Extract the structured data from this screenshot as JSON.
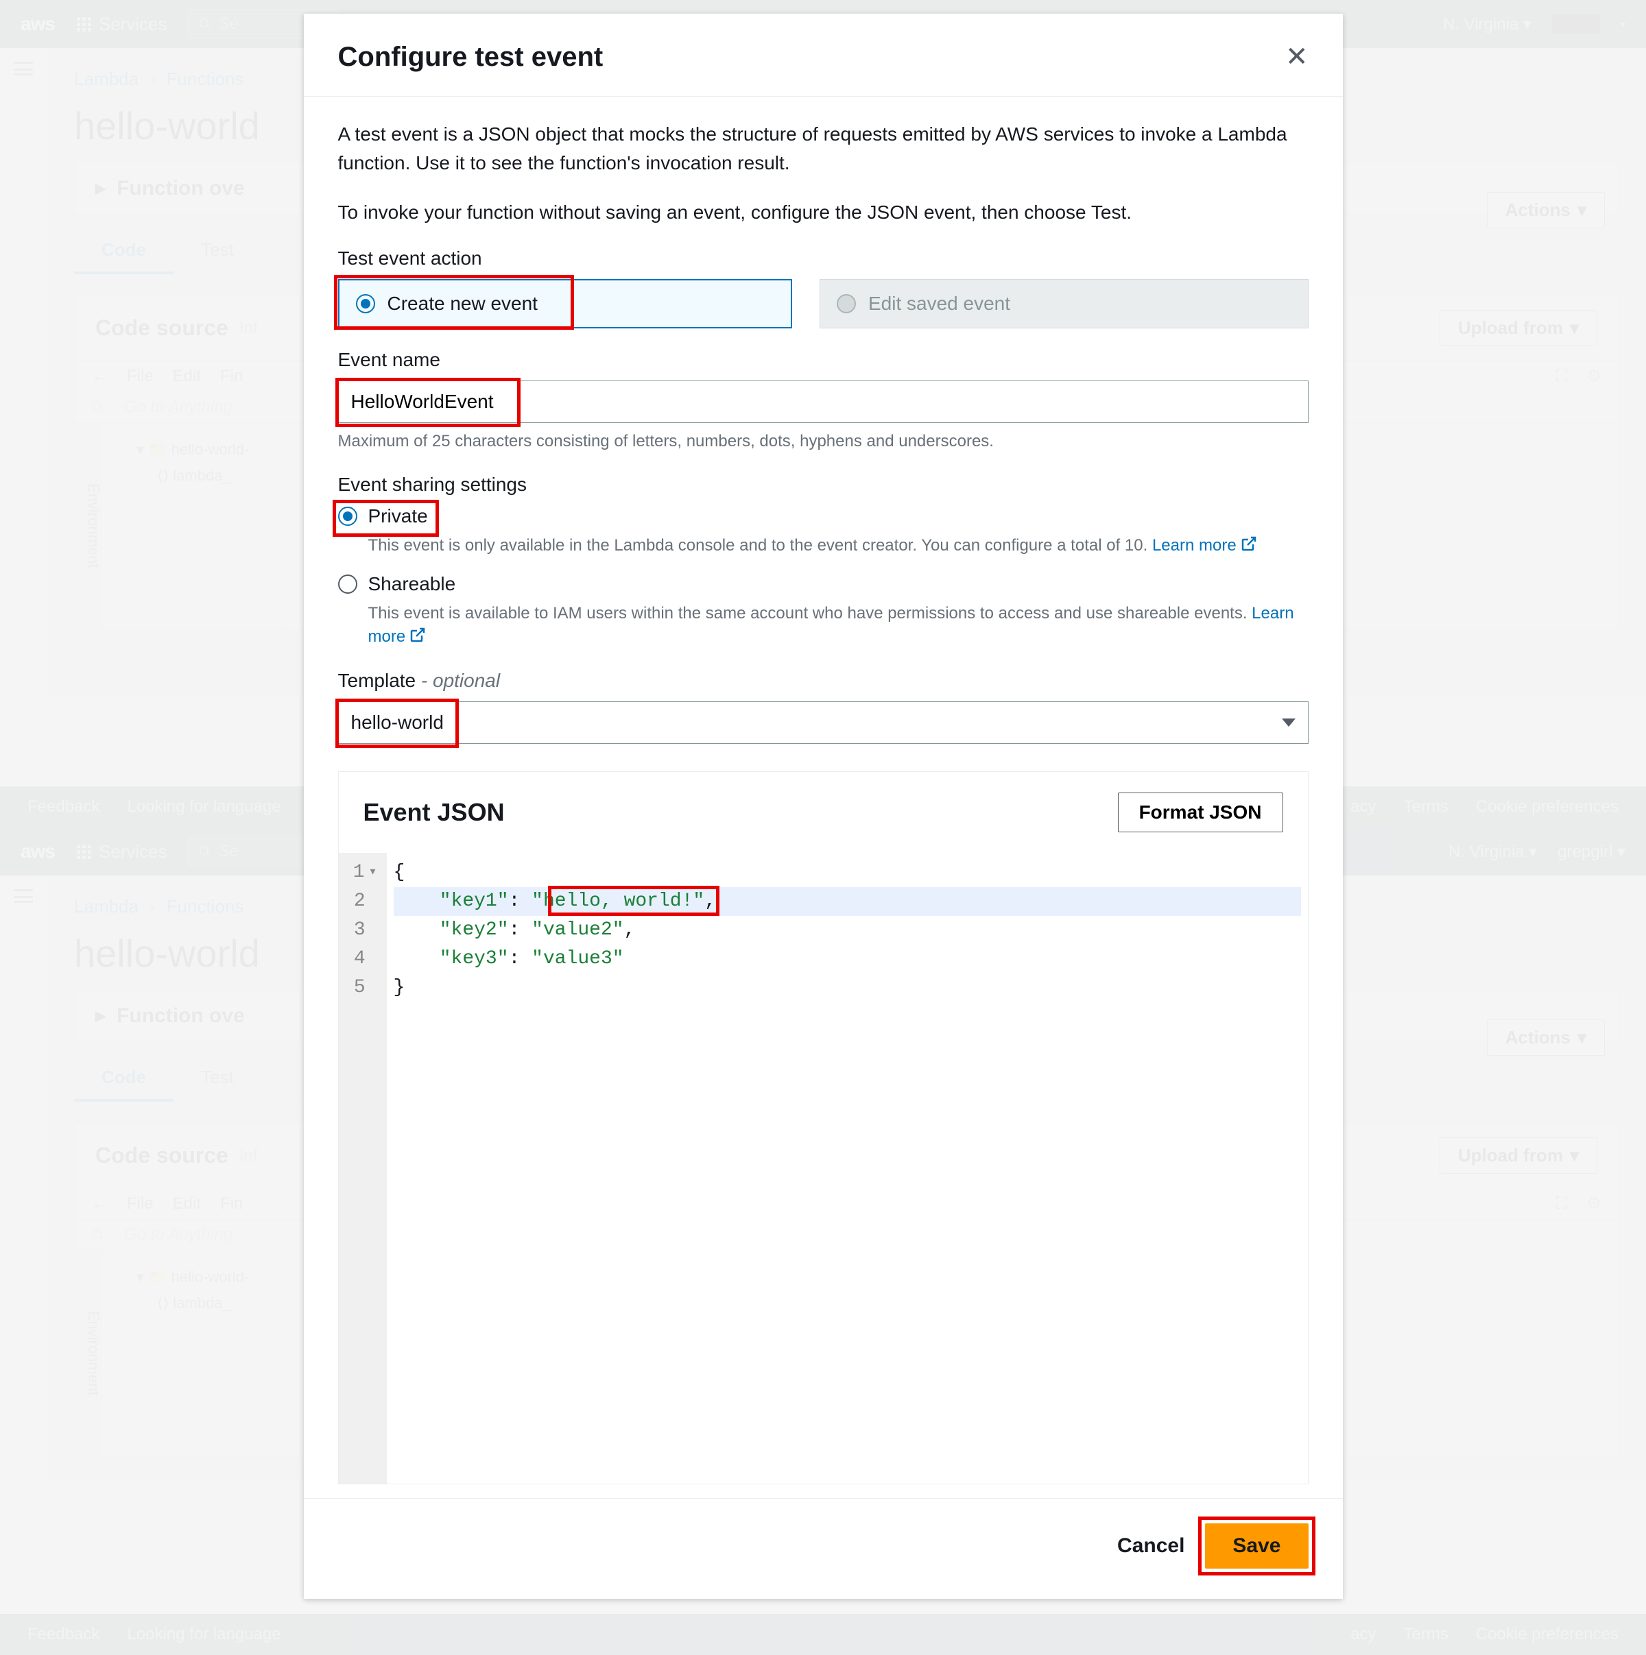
{
  "header": {
    "logo": "aws",
    "services": "Services",
    "search_placeholder": "Se",
    "region": "N. Virginia",
    "user2": "grepgirl"
  },
  "breadcrumb": {
    "a": "Lambda",
    "b": "Functions"
  },
  "page_title": "hello-world",
  "panel_overview": "Function ove",
  "tabs": {
    "code": "Code",
    "test": "Test"
  },
  "code_source": {
    "title": "Code source",
    "info": "Inf",
    "menu_file": "File",
    "menu_edit": "Edit",
    "menu_find": "Fin",
    "goto": "Go to Anything",
    "env": "Environment",
    "tree_root": "hello-world-",
    "tree_file": "lambda_",
    "upload": "Upload from"
  },
  "buttons": {
    "actions": "Actions"
  },
  "footer": {
    "feedback": "Feedback",
    "lang": "Looking for language",
    "privacy": "acy",
    "terms": "Terms",
    "cookies": "Cookie preferences"
  },
  "modal": {
    "title": "Configure test event",
    "desc1": "A test event is a JSON object that mocks the structure of requests emitted by AWS services to invoke a Lambda function. Use it to see the function's invocation result.",
    "desc2": "To invoke your function without saving an event, configure the JSON event, then choose Test.",
    "action_label": "Test event action",
    "action_create": "Create new event",
    "action_edit": "Edit saved event",
    "name_label": "Event name",
    "name_value": "HelloWorldEvent",
    "name_hint": "Maximum of 25 characters consisting of letters, numbers, dots, hyphens and underscores.",
    "sharing_label": "Event sharing settings",
    "private_label": "Private",
    "private_hint": "This event is only available in the Lambda console and to the event creator. You can configure a total of 10.",
    "shareable_label": "Shareable",
    "shareable_hint": "This event is available to IAM users within the same account who have permissions to access and use shareable events.",
    "learn_more": "Learn more",
    "template_label": "Template",
    "template_optional": "- optional",
    "template_value": "hello-world",
    "json_title": "Event JSON",
    "format_btn": "Format JSON",
    "json_lines": {
      "l1_open": "{",
      "l2_key": "\"key1\"",
      "l2_val": "\"hello, world!\"",
      "l3_key": "\"key2\"",
      "l3_val": "\"value2\"",
      "l4_key": "\"key3\"",
      "l4_val": "\"value3\"",
      "l5_close": "}"
    },
    "cancel": "Cancel",
    "save": "Save"
  }
}
